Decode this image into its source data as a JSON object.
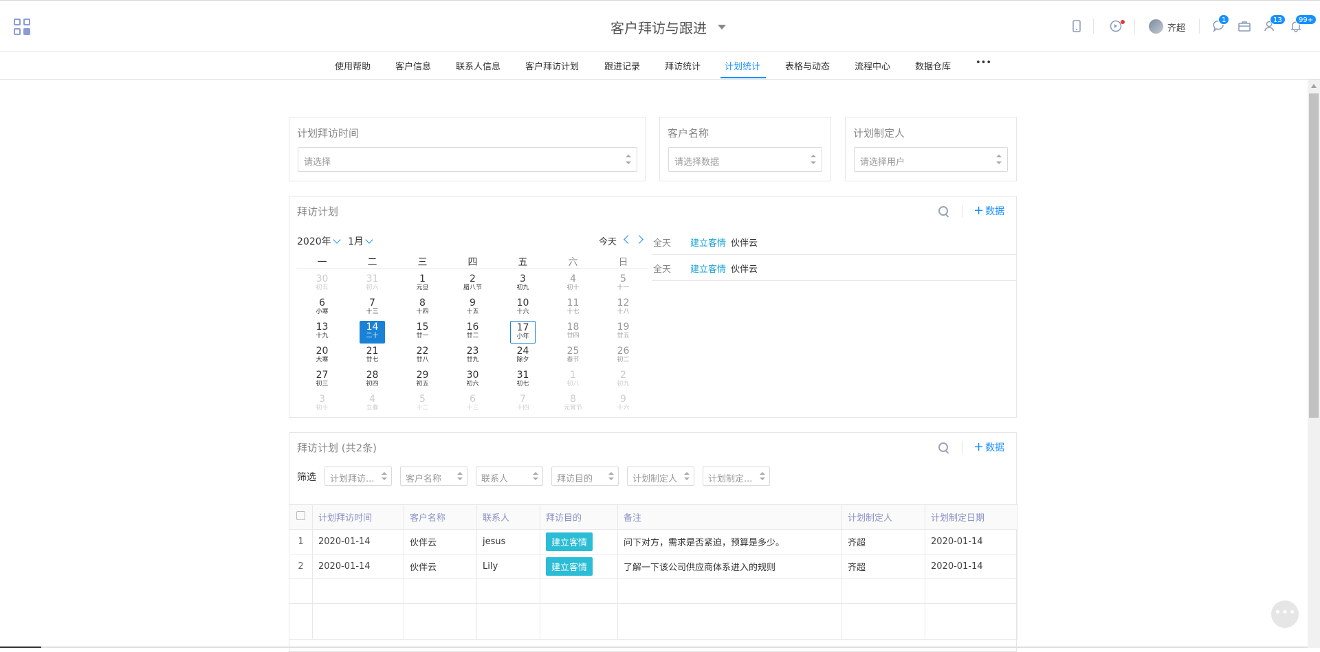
{
  "app": {
    "title": "客户拜访与跟进",
    "user": "齐超"
  },
  "header_icons": [
    {
      "name": "mobile-icon"
    },
    {
      "name": "compass-icon"
    },
    {
      "name": "chat-icon",
      "badge": "1"
    },
    {
      "name": "briefcase-icon"
    },
    {
      "name": "contacts-icon",
      "badge": "13"
    },
    {
      "name": "bell-icon",
      "badge": "99+"
    }
  ],
  "nav": {
    "items": [
      "使用帮助",
      "客户信息",
      "联系人信息",
      "客户拜访计划",
      "跟进记录",
      "拜访统计",
      "计划统计",
      "表格与动态",
      "流程中心",
      "数据仓库"
    ],
    "active": "计划统计",
    "more": "•••"
  },
  "filters": {
    "visit_time": {
      "label": "计划拜访时间",
      "placeholder": "请选择"
    },
    "customer": {
      "label": "客户名称",
      "placeholder": "请选择数据"
    },
    "planner": {
      "label": "计划制定人",
      "placeholder": "请选择用户"
    }
  },
  "calendar_panel": {
    "title": "拜访计划",
    "add_label": "数据",
    "year": "2020年",
    "month": "1月",
    "today": "今天",
    "weekdays": [
      "一",
      "二",
      "三",
      "四",
      "五",
      "六",
      "日"
    ],
    "weeks": [
      [
        [
          "30",
          "初五",
          "o"
        ],
        [
          "31",
          "初六",
          "o"
        ],
        [
          "1",
          "元旦",
          ""
        ],
        [
          "2",
          "腊八节",
          ""
        ],
        [
          "3",
          "初九",
          ""
        ],
        [
          "4",
          "初十",
          "w"
        ],
        [
          "5",
          "十一",
          "w"
        ]
      ],
      [
        [
          "6",
          "小寒",
          ""
        ],
        [
          "7",
          "十三",
          ""
        ],
        [
          "8",
          "十四",
          ""
        ],
        [
          "9",
          "十五",
          ""
        ],
        [
          "10",
          "十六",
          ""
        ],
        [
          "11",
          "十七",
          "w"
        ],
        [
          "12",
          "十八",
          "w"
        ]
      ],
      [
        [
          "13",
          "十九",
          ""
        ],
        [
          "14",
          "二十",
          "s"
        ],
        [
          "15",
          "廿一",
          ""
        ],
        [
          "16",
          "廿二",
          ""
        ],
        [
          "17",
          "小年",
          "t"
        ],
        [
          "18",
          "廿四",
          "w"
        ],
        [
          "19",
          "廿五",
          "w"
        ]
      ],
      [
        [
          "20",
          "大寒",
          ""
        ],
        [
          "21",
          "廿七",
          ""
        ],
        [
          "22",
          "廿八",
          ""
        ],
        [
          "23",
          "廿九",
          ""
        ],
        [
          "24",
          "除夕",
          ""
        ],
        [
          "25",
          "春节",
          "w"
        ],
        [
          "26",
          "初二",
          "w"
        ]
      ],
      [
        [
          "27",
          "初三",
          ""
        ],
        [
          "28",
          "初四",
          ""
        ],
        [
          "29",
          "初五",
          ""
        ],
        [
          "30",
          "初六",
          ""
        ],
        [
          "31",
          "初七",
          ""
        ],
        [
          "1",
          "初八",
          "o"
        ],
        [
          "2",
          "初九",
          "o"
        ]
      ],
      [
        [
          "3",
          "初十",
          "o"
        ],
        [
          "4",
          "立春",
          "o"
        ],
        [
          "5",
          "十二",
          "o"
        ],
        [
          "6",
          "十三",
          "o"
        ],
        [
          "7",
          "十四",
          "o"
        ],
        [
          "8",
          "元宵节",
          "o"
        ],
        [
          "9",
          "十六",
          "o"
        ]
      ]
    ],
    "events": [
      {
        "allday": "全天",
        "tag": "建立客情",
        "customer": "伙伴云"
      },
      {
        "allday": "全天",
        "tag": "建立客情",
        "customer": "伙伴云"
      }
    ]
  },
  "list_panel": {
    "title": "拜访计划 (共2条)",
    "add_label": "数据",
    "filter_label": "筛选",
    "filter_selects": [
      "计划拜访...",
      "客户名称",
      "联系人",
      "拜访目的",
      "计划制定人",
      "计划制定..."
    ],
    "columns": [
      "计划拜访时间",
      "客户名称",
      "联系人",
      "拜访目的",
      "备注",
      "计划制定人",
      "计划制定日期"
    ],
    "rows": [
      {
        "idx": "1",
        "time": "2020-01-14",
        "customer": "伙伴云",
        "contact": "jesus",
        "purpose": "建立客情",
        "note": "问下对方，需求是否紧迫，预算是多少。",
        "planner": "齐超",
        "date": "2020-01-14"
      },
      {
        "idx": "2",
        "time": "2020-01-14",
        "customer": "伙伴云",
        "contact": "Lily",
        "purpose": "建立客情",
        "note": "了解一下该公司供应商体系进入的规则",
        "planner": "齐超",
        "date": "2020-01-14"
      }
    ]
  },
  "colors": {
    "accent": "#1890ff",
    "tag": "#2bbcd6",
    "selected_day": "#1a82d6"
  }
}
